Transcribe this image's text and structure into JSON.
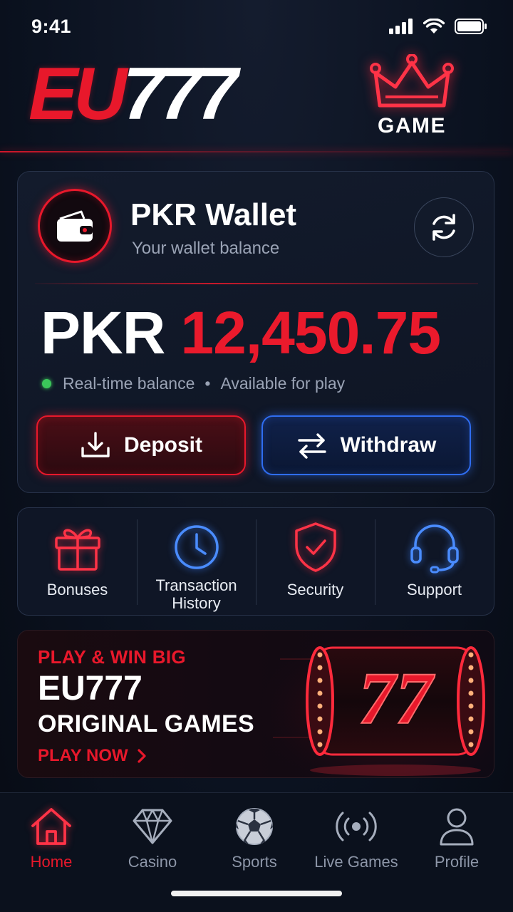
{
  "status_bar": {
    "time": "9:41"
  },
  "header": {
    "logo_part1": "EU",
    "logo_part2": "777",
    "game_label": "GAME"
  },
  "wallet": {
    "title": "PKR Wallet",
    "subtitle": "Your wallet balance",
    "currency": "PKR",
    "amount": "12,450.75",
    "note_part1": "Real-time balance",
    "note_sep": "•",
    "note_part2": "Available for play",
    "deposit_label": "Deposit",
    "withdraw_label": "Withdraw"
  },
  "quick_actions": [
    {
      "label": "Bonuses",
      "icon": "gift-icon"
    },
    {
      "label": "Transaction History",
      "icon": "clock-icon"
    },
    {
      "label": "Security",
      "icon": "shield-check-icon"
    },
    {
      "label": "Support",
      "icon": "headset-icon"
    }
  ],
  "promo": {
    "kicker": "PLAY & WIN BIG",
    "title1": "EU777",
    "title2": "ORIGINAL GAMES",
    "cta": "PLAY NOW",
    "slot_symbols": "77"
  },
  "bottom_nav": {
    "active": "Home",
    "items": [
      {
        "label": "Home",
        "icon": "home-icon"
      },
      {
        "label": "Casino",
        "icon": "diamond-icon"
      },
      {
        "label": "Sports",
        "icon": "soccer-ball-icon"
      },
      {
        "label": "Live Games",
        "icon": "broadcast-icon"
      },
      {
        "label": "Profile",
        "icon": "user-icon"
      }
    ]
  },
  "colors": {
    "accent_red": "#e8182b",
    "accent_blue": "#2f6df0",
    "online_green": "#3bc65a",
    "background": "#0b1220"
  }
}
